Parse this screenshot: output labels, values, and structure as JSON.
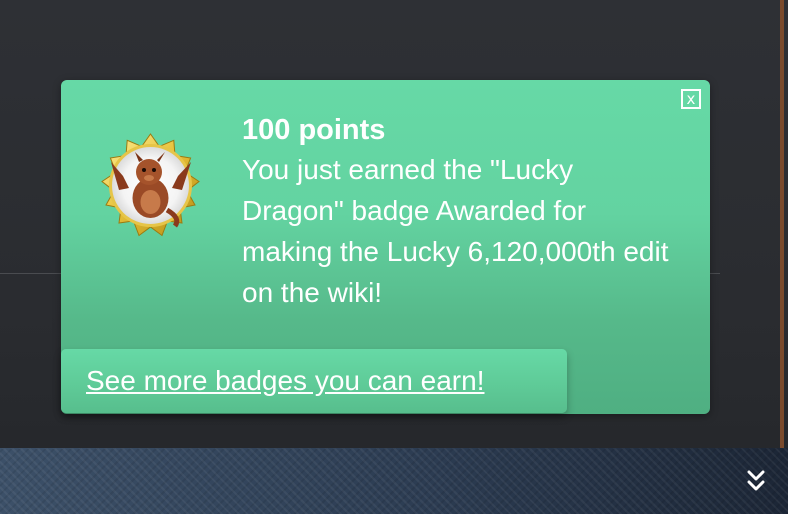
{
  "notification": {
    "close_label": "x",
    "points": "100 points",
    "message": "You just earned the \"Lucky Dragon\" badge Awarded for making the Lucky 6,120,000th edit on the wiki!",
    "badge_icon": "lucky-dragon-badge",
    "more_badges_link": "See more badges you can earn!"
  },
  "colors": {
    "notification_green": "#63d3a1",
    "text": "#ffffff",
    "page_background": "#2b2d31",
    "bottom_bar": "#34465e"
  },
  "bottom_bar": {
    "icon": "double-chevron-down-icon"
  }
}
